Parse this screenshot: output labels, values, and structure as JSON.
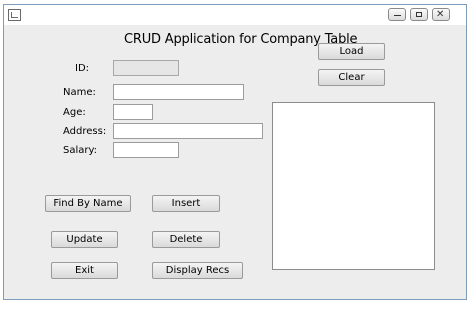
{
  "window": {
    "title": ""
  },
  "form": {
    "heading": "CRUD Application for Company Table",
    "labels": {
      "id": "ID:",
      "name": "Name:",
      "age": "Age:",
      "address": "Address:",
      "salary": "Salary:"
    },
    "values": {
      "id": "",
      "name": "",
      "age": "",
      "address": "",
      "salary": ""
    }
  },
  "buttons": {
    "load": "Load",
    "clear": "Clear",
    "find_by_name": "Find By Name",
    "insert": "Insert",
    "update": "Update",
    "delete": "Delete",
    "exit": "Exit",
    "display_recs": "Display Recs"
  },
  "output_area": {
    "text": ""
  }
}
